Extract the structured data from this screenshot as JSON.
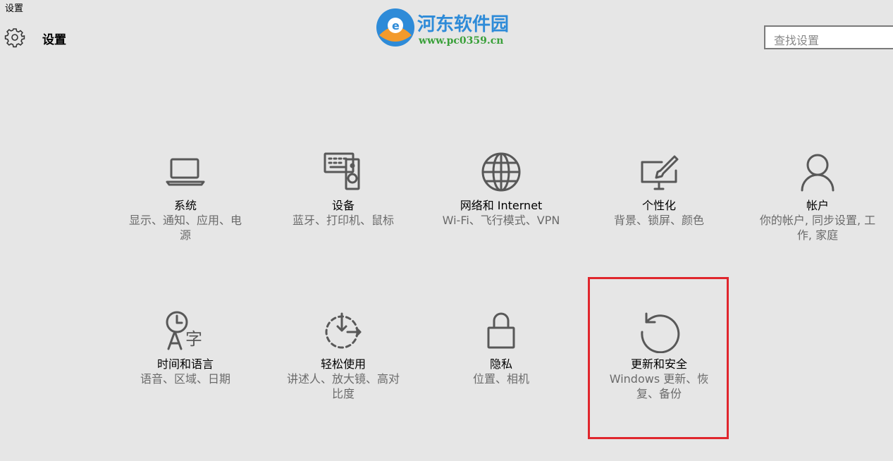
{
  "window": {
    "title": "设置"
  },
  "header": {
    "title": "设置"
  },
  "search": {
    "placeholder": "查找设置"
  },
  "watermark": {
    "name": "河东软件园",
    "url": "www.pc0359.cn"
  },
  "tiles": [
    {
      "title": "系统",
      "desc": "显示、通知、应用、电源",
      "icon": "laptop-icon"
    },
    {
      "title": "设备",
      "desc": "蓝牙、打印机、鼠标",
      "icon": "keyboard-speaker-icon"
    },
    {
      "title": "网络和 Internet",
      "desc": "Wi-Fi、飞行模式、VPN",
      "icon": "globe-icon"
    },
    {
      "title": "个性化",
      "desc": "背景、锁屏、颜色",
      "icon": "paint-monitor-icon"
    },
    {
      "title": "帐户",
      "desc": "你的帐户, 同步设置, 工作, 家庭",
      "icon": "person-icon"
    },
    {
      "title": "时间和语言",
      "desc": "语音、区域、日期",
      "icon": "clock-language-icon"
    },
    {
      "title": "轻松使用",
      "desc": "讲述人、放大镜、高对比度",
      "icon": "ease-of-access-icon"
    },
    {
      "title": "隐私",
      "desc": "位置、相机",
      "icon": "lock-icon"
    },
    {
      "title": "更新和安全",
      "desc": "Windows 更新、恢复、备份",
      "icon": "refresh-icon"
    }
  ],
  "highlight_color": "#e0262d"
}
